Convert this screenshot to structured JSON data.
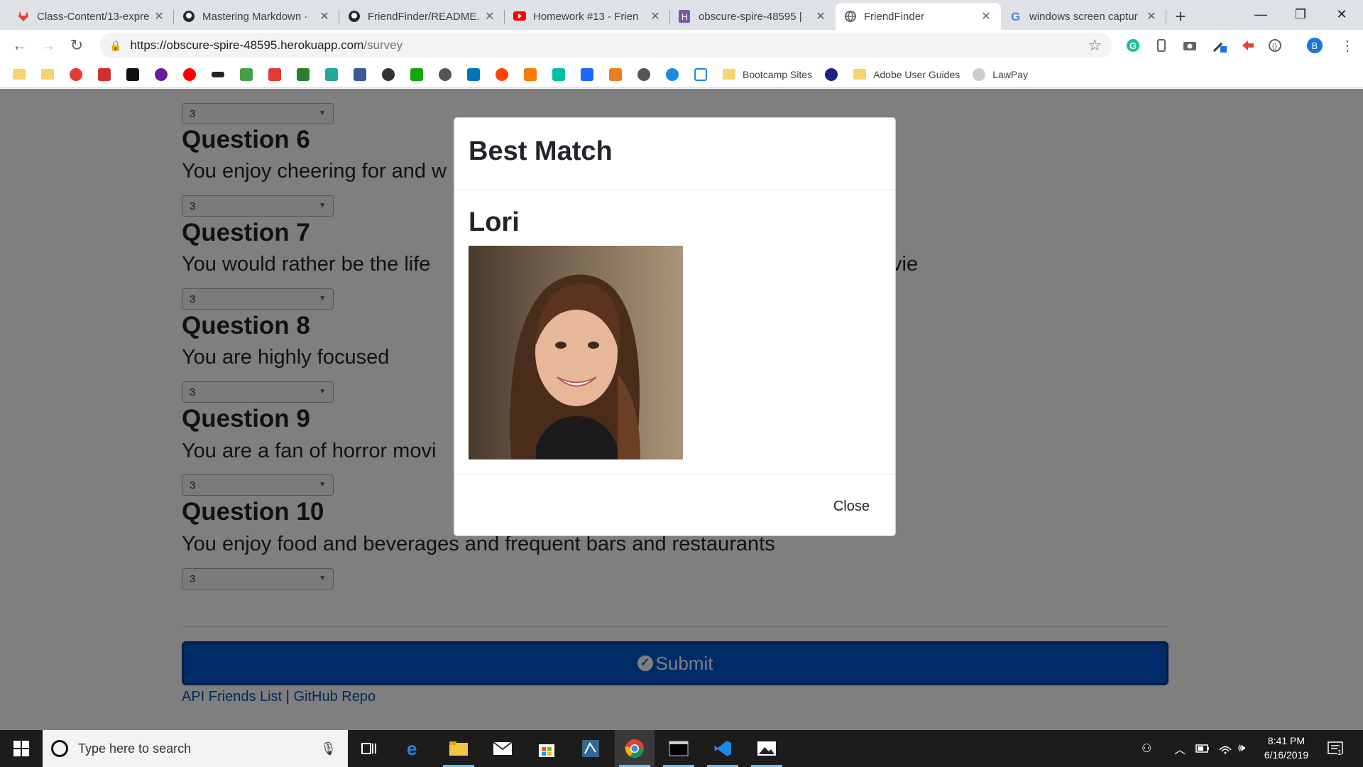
{
  "browser": {
    "tabs": [
      {
        "title": "Class-Content/13-expre",
        "icon": "gitlab-icon",
        "color": "#e24329"
      },
      {
        "title": "Mastering Markdown · ",
        "icon": "github-icon",
        "color": "#24292e"
      },
      {
        "title": "FriendFinder/README.",
        "icon": "github-icon",
        "color": "#24292e"
      },
      {
        "title": "Homework #13 - Frien",
        "icon": "youtube-icon",
        "color": "#ff0000"
      },
      {
        "title": "obscure-spire-48595 | ",
        "icon": "heroku-icon",
        "color": "#79589f"
      },
      {
        "title": "FriendFinder",
        "icon": "globe-icon",
        "color": "#5f6368",
        "active": true
      },
      {
        "title": "windows screen captur",
        "icon": "google-icon",
        "color": "#4285f4"
      }
    ],
    "new_tab": "+",
    "window_controls": {
      "minimize": "—",
      "restore": "❐",
      "close": "✕"
    },
    "address": {
      "host": "https://obscure-spire-48595.herokuapp.com",
      "path": "/survey"
    },
    "profile_letter": "B",
    "bookmarks": [
      {
        "label": "Bootcamp Sites"
      },
      {
        "label": "Adobe User Guides"
      },
      {
        "label": "LawPay"
      }
    ]
  },
  "survey": {
    "questions": [
      {
        "title": "Question 6",
        "text": "You enjoy cheering for and w",
        "value": "3"
      },
      {
        "title": "Question 7",
        "text": "You would rather be the life",
        "text_tail": "vie",
        "value": "3"
      },
      {
        "title": "Question 8",
        "text": "You are highly focused",
        "value": "3"
      },
      {
        "title": "Question 9",
        "text": "You are a fan of horror movi",
        "value": "3"
      },
      {
        "title": "Question 10",
        "text": "You enjoy food and beverages and frequent bars and restaurants",
        "value": "3"
      }
    ],
    "prev_value": "3",
    "submit_label": "Submit",
    "links": {
      "api": "API Friends List",
      "separator": " | ",
      "repo": "GitHub Repo"
    }
  },
  "modal": {
    "title": "Best Match",
    "match_name": "Lori",
    "close_label": "Close"
  },
  "taskbar": {
    "search_placeholder": "Type here to search",
    "time": "8:41 PM",
    "date": "6/16/2019",
    "notification_count": "1"
  },
  "colors": {
    "submit": "#0056d2",
    "link": "#0056b3",
    "taskbar": "#1c1c1c"
  }
}
